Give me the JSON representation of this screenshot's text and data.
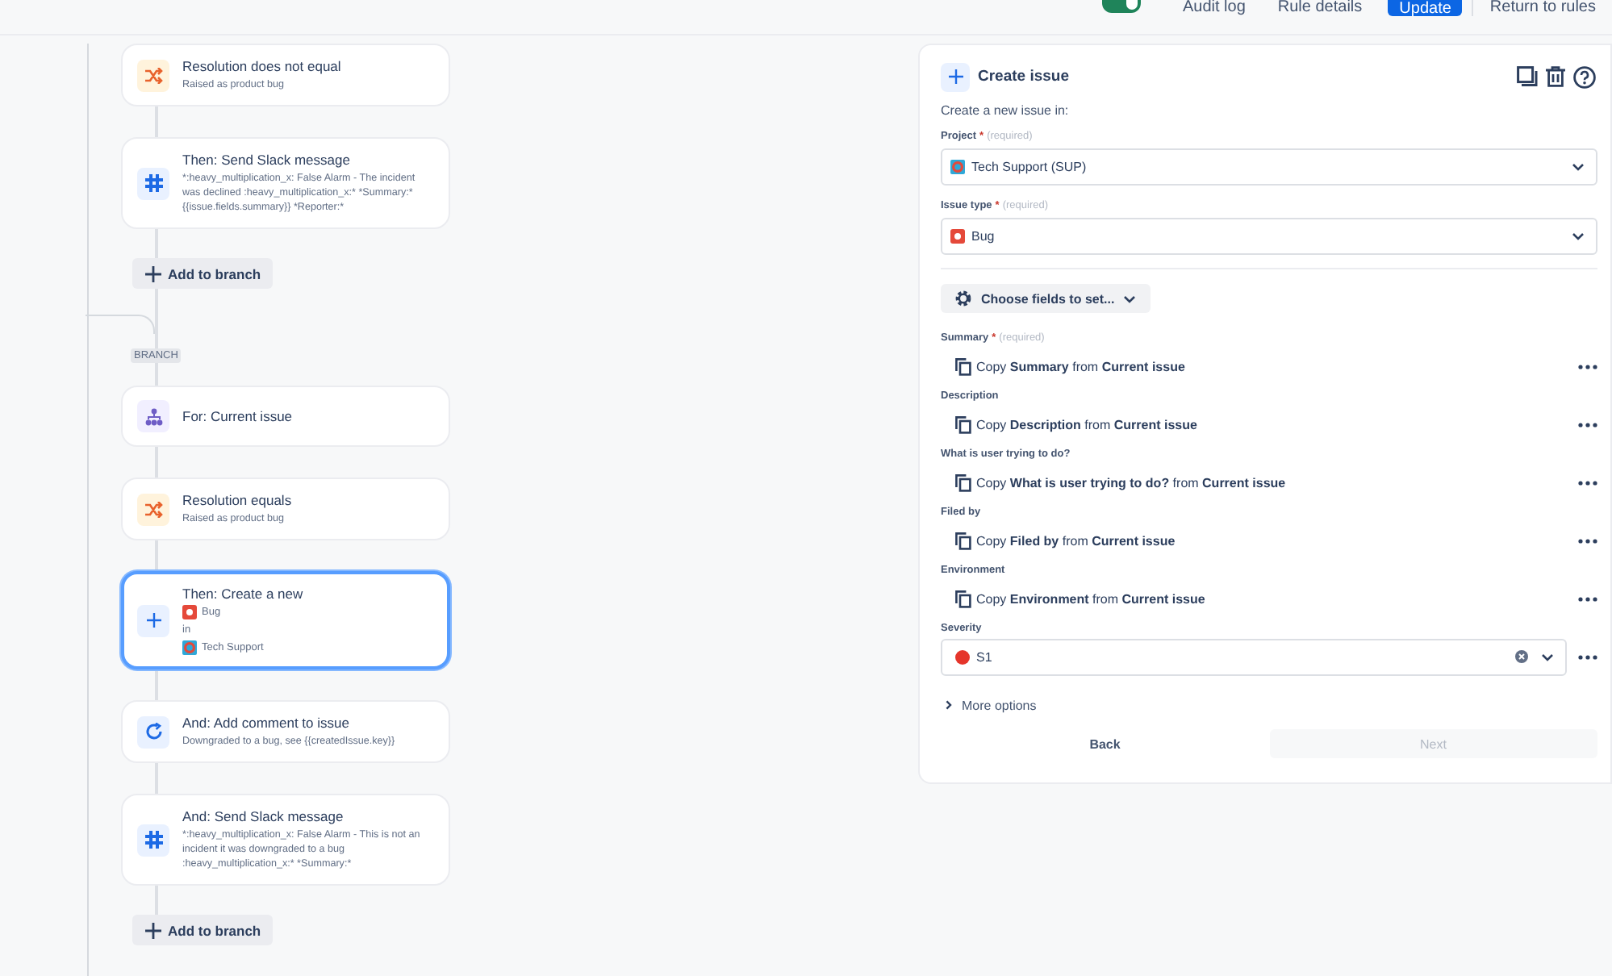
{
  "topbar": {
    "toggle": {
      "on": true
    },
    "links": [
      {
        "label": "Audit log",
        "kind": "link"
      },
      {
        "label": "Rule details",
        "kind": "link"
      },
      {
        "label": "Update",
        "kind": "primary"
      },
      {
        "label": "Return to rules",
        "kind": "link"
      }
    ]
  },
  "flow": [
    {
      "kind": "condition",
      "title": "Resolution does not equal",
      "subtitle": "Raised as product bug",
      "selected": false
    },
    {
      "kind": "slack",
      "title": "Then: Send Slack message",
      "subtitle": "*:heavy_multiplication_x: False Alarm - The incident was declined :heavy_multiplication_x:* *Summary:* {{issue.fields.summary}} *Reporter:*",
      "selected": false
    },
    {
      "kind": "add",
      "label": "Add to branch"
    },
    {
      "kind": "branch",
      "label": "BRANCH"
    },
    {
      "kind": "for",
      "title": "For: Current issue",
      "selected": false
    },
    {
      "kind": "condition",
      "title": "Resolution equals",
      "subtitle": "Raised as product bug",
      "selected": false
    },
    {
      "kind": "create",
      "title": "Then: Create a new",
      "lines": [
        {
          "kind": "bug",
          "text": "Bug"
        },
        {
          "kind": "plain",
          "text": "in"
        },
        {
          "kind": "project",
          "text": "Tech Support"
        }
      ],
      "selected": true
    },
    {
      "kind": "comment",
      "title": "And: Add comment to issue",
      "subtitle": "Downgraded to a bug, see {{createdIssue.key}}",
      "selected": false
    },
    {
      "kind": "slack",
      "title": "And: Send Slack message",
      "subtitle": "*:heavy_multiplication_x: False Alarm - This is not an incident it was downgraded to a bug :heavy_multiplication_x:* *Summary:*",
      "selected": false
    },
    {
      "kind": "add",
      "label": "Add to branch"
    }
  ],
  "panel": {
    "title": "Create issue",
    "intro": "Create a new issue in:",
    "selects": [
      {
        "label": "Project",
        "required_mark": "*",
        "hint": "(required)",
        "value": "Tech Support (SUP)",
        "kind": "project"
      },
      {
        "label": "Issue type",
        "required_mark": "*",
        "hint": "(required)",
        "value": "Bug",
        "kind": "bug"
      }
    ],
    "choose_button": "Choose fields to set...",
    "fields": [
      {
        "kind": "copy",
        "label": "Summary",
        "required_mark": "*",
        "hint": "(required)",
        "value": "Copy **Summary** from **Current issue**"
      },
      {
        "kind": "copy",
        "label": "Description",
        "value": "Copy **Description** from **Current issue**"
      },
      {
        "kind": "copy",
        "label": "What is user trying to do?",
        "value": "Copy **What is user trying to do?** from **Current issue**"
      },
      {
        "kind": "copy",
        "label": "Filed by",
        "value": "Copy **Filed by** from **Current issue**"
      },
      {
        "kind": "copy",
        "label": "Environment",
        "value": "Copy **Environment** from **Current issue**"
      },
      {
        "kind": "select",
        "label": "Severity",
        "value": "S1",
        "color": "#e5352b"
      }
    ],
    "more_options": "More options",
    "back": "Back",
    "next": {
      "label": "Next",
      "disabled": true
    }
  }
}
